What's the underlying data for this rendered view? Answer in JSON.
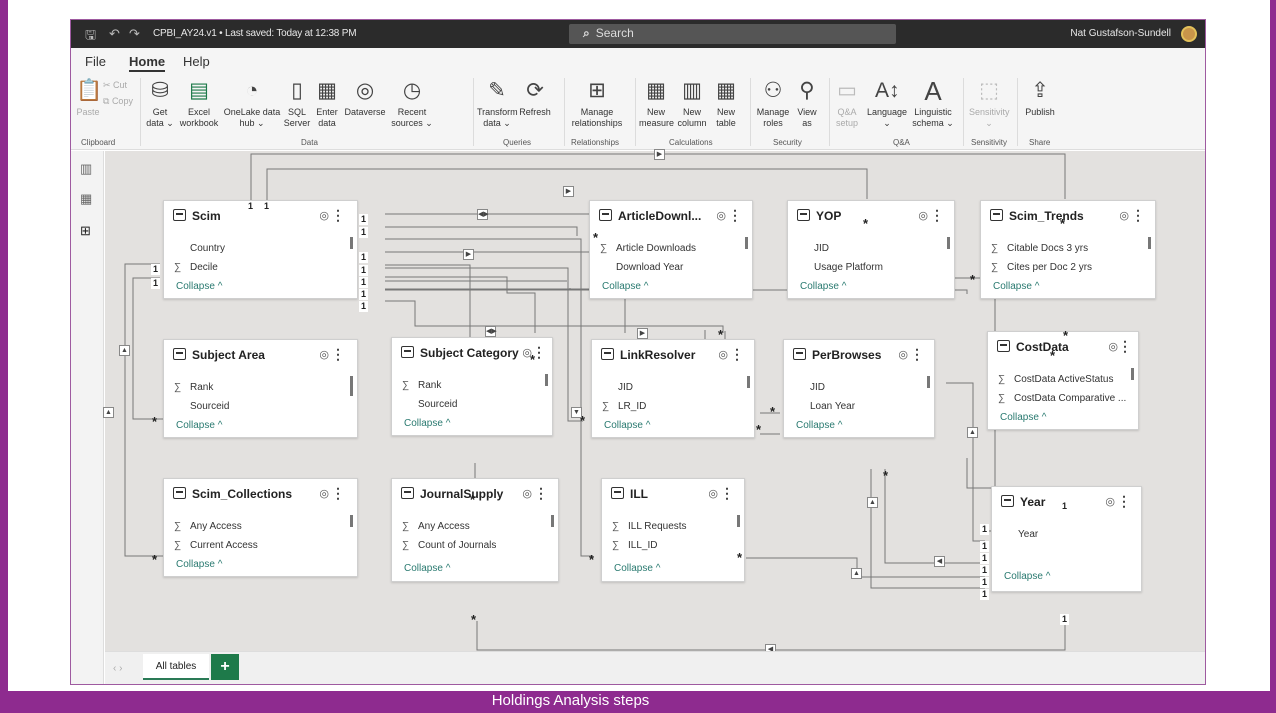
{
  "titlebar": {
    "doc_title": "CPBI_AY24.v1 • Last saved: Today at 12:38 PM",
    "search": "Search",
    "user": "Nat Gustafson-Sundell"
  },
  "menu": {
    "file": "File",
    "home": "Home",
    "help": "Help"
  },
  "ribbon": {
    "paste": "Paste",
    "cut": "Cut",
    "copy": "Copy",
    "get_data": "Get\ndata ⌄",
    "excel": "Excel\nworkbook",
    "onelake": "OneLake data\nhub ⌄",
    "sql": "SQL\nServer",
    "enter_data": "Enter\ndata",
    "dataverse": "Dataverse",
    "recent": "Recent\nsources ⌄",
    "transform": "Transform\ndata ⌄",
    "refresh": "Refresh",
    "manage_rel": "Manage\nrelationships",
    "new_measure": "New\nmeasure",
    "new_column": "New\ncolumn",
    "new_table": "New\ntable",
    "manage_roles": "Manage\nroles",
    "view_as": "View\nas",
    "qa_setup": "Q&A\nsetup",
    "language": "Language\n⌄",
    "linguistic": "Linguistic\nschema ⌄",
    "sensitivity": "Sensitivity\n⌄",
    "publish": "Publish",
    "groups": {
      "clipboard": "Clipboard",
      "data": "Data",
      "queries": "Queries",
      "relationships": "Relationships",
      "calculations": "Calculations",
      "security": "Security",
      "qa": "Q&A",
      "sensitivity": "Sensitivity",
      "share": "Share"
    }
  },
  "cards": {
    "scim": {
      "title": "Scim",
      "f1": "Country",
      "f2": "Decile",
      "collapse": "Collapse ^"
    },
    "article": {
      "title": "ArticleDownl...",
      "f1": "Article Downloads",
      "f2": "Download Year",
      "collapse": "Collapse ^"
    },
    "yop": {
      "title": "YOP",
      "f1": "JID",
      "f2": "Usage Platform",
      "collapse": "Collapse ^"
    },
    "trends": {
      "title": "Scim_Trends",
      "f1": "Citable Docs 3 yrs",
      "f2": "Cites per Doc 2 yrs",
      "collapse": "Collapse ^"
    },
    "subject_area": {
      "title": "Subject Area",
      "f1": "Rank",
      "f2": "Sourceid",
      "collapse": "Collapse ^"
    },
    "subject_cat": {
      "title": "Subject Category",
      "f1": "Rank",
      "f2": "Sourceid",
      "collapse": "Collapse ^"
    },
    "link": {
      "title": "LinkResolver",
      "f1": "JID",
      "f2": "LR_ID",
      "collapse": "Collapse ^"
    },
    "perbrowses": {
      "title": "PerBrowses",
      "f1": "JID",
      "f2": "Loan Year",
      "collapse": "Collapse ^"
    },
    "costdata": {
      "title": "CostData",
      "f1": "CostData ActiveStatus",
      "f2": "CostData Comparative ...",
      "collapse": "Collapse ^"
    },
    "collections": {
      "title": "Scim_Collections",
      "f1": "Any Access",
      "f2": "Current Access",
      "collapse": "Collapse ^"
    },
    "journal": {
      "title": "JournalSupply",
      "f1": "Any Access",
      "f2": "Count of Journals",
      "collapse": "Collapse ^"
    },
    "ill": {
      "title": "ILL",
      "f1": "ILL Requests",
      "f2": "ILL_ID",
      "collapse": "Collapse ^"
    },
    "year": {
      "title": "Year",
      "f1": "Year",
      "collapse": "Collapse ^"
    }
  },
  "card_ui": {
    "sigma": "∑",
    "eye": "◎",
    "dots": "⋮",
    "one": "1",
    "many": "*"
  },
  "tabs": {
    "nav": "‹  ›",
    "all": "All tables",
    "add": "+"
  },
  "caption": "Holdings Analysis steps",
  "colors": {
    "accent": "#8e2b8f",
    "collapse": "#2a7a70",
    "tab_add": "#1e7a4a"
  }
}
